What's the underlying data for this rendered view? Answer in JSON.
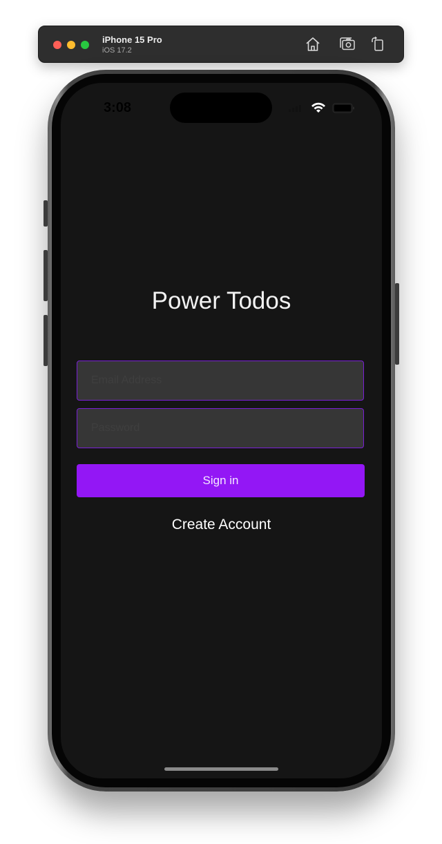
{
  "simulator": {
    "device_name": "iPhone 15 Pro",
    "os_version": "iOS 17.2",
    "icons": [
      "home-icon",
      "screenshot-icon",
      "rotate-icon"
    ]
  },
  "status_bar": {
    "time": "3:08",
    "icons": [
      "cellular-icon",
      "wifi-icon",
      "battery-icon"
    ]
  },
  "app": {
    "title": "Power Todos",
    "email_placeholder": "Email Address",
    "password_placeholder": "Password",
    "sign_in_label": "Sign in",
    "create_account_label": "Create Account"
  },
  "colors": {
    "screen_background": "#151515",
    "accent": "#9317f5",
    "field_background": "#363636",
    "field_border": "#7a1fd6"
  }
}
